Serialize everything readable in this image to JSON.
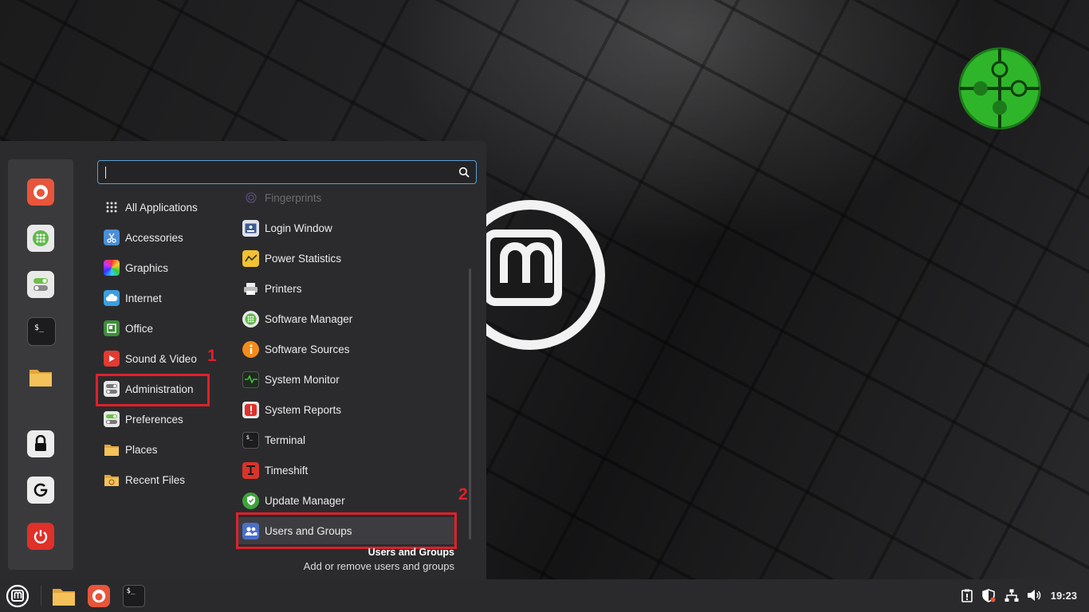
{
  "search": {
    "value": "",
    "placeholder": ""
  },
  "categories": [
    {
      "label": "All Applications",
      "icon": "grid-icon"
    },
    {
      "label": "Accessories",
      "icon": "scissors-icon"
    },
    {
      "label": "Graphics",
      "icon": "graphics-icon"
    },
    {
      "label": "Internet",
      "icon": "cloud-icon"
    },
    {
      "label": "Office",
      "icon": "office-icon"
    },
    {
      "label": "Sound & Video",
      "icon": "play-icon"
    },
    {
      "label": "Administration",
      "icon": "toggles-icon"
    },
    {
      "label": "Preferences",
      "icon": "toggles-icon"
    },
    {
      "label": "Places",
      "icon": "folder-icon"
    },
    {
      "label": "Recent Files",
      "icon": "folder-clock-icon"
    }
  ],
  "apps": [
    {
      "label": "Fingerprints",
      "icon": "fingerprint-icon"
    },
    {
      "label": "Login Window",
      "icon": "login-window-icon"
    },
    {
      "label": "Power Statistics",
      "icon": "power-statistics-icon"
    },
    {
      "label": "Printers",
      "icon": "printer-icon"
    },
    {
      "label": "Software Manager",
      "icon": "software-manager-icon"
    },
    {
      "label": "Software Sources",
      "icon": "info-icon"
    },
    {
      "label": "System Monitor",
      "icon": "system-monitor-icon"
    },
    {
      "label": "System Reports",
      "icon": "warning-icon"
    },
    {
      "label": "Terminal",
      "icon": "terminal-icon"
    },
    {
      "label": "Timeshift",
      "icon": "timeshift-icon"
    },
    {
      "label": "Update Manager",
      "icon": "shield-icon"
    },
    {
      "label": "Users and Groups",
      "icon": "users-icon"
    }
  ],
  "annotations": {
    "one": "1",
    "two": "2"
  },
  "description": {
    "title": "Users and Groups",
    "text": "Add or remove users and groups"
  },
  "favorites": [
    "firefox-icon",
    "software-manager-icon",
    "settings-toggles-icon",
    "terminal-icon",
    "files-folder-icon",
    "lock-icon",
    "logout-icon",
    "power-icon"
  ],
  "taskbar": {
    "launchers": [
      "mint-menu-icon",
      "files-folder-icon",
      "firefox-icon",
      "terminal-icon"
    ],
    "tray": [
      "clipboard-icon",
      "shield-icon",
      "network-icon",
      "volume-icon"
    ],
    "clock": "19:23"
  },
  "terminal_glyph": "$_",
  "colors": {
    "accent": "#5a9fd4",
    "highlight": "#e0202a",
    "menu_bg": "#2b2b2e"
  }
}
